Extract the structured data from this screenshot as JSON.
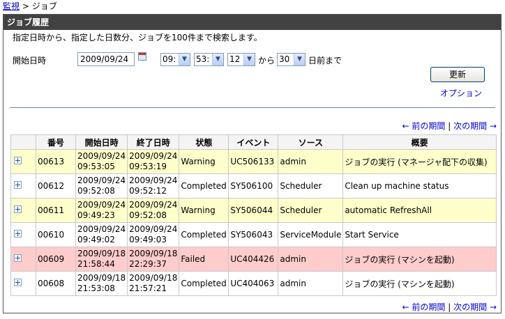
{
  "breadcrumb": {
    "link": "監視",
    "current": "> ジョブ"
  },
  "panel": {
    "title": "ジョブ履歴"
  },
  "search": {
    "description": "指定日時から、指定した日数分、ジョブを100件まで検索します。",
    "start_label": "開始日時",
    "date_value": "2009/09/24",
    "hour": "09:",
    "minute": "53:",
    "second": "12",
    "from_label": "から",
    "days": "30",
    "days_suffix": "日前まで",
    "update_button": "更新",
    "option_link": "オプション"
  },
  "pager": {
    "prev": "← 前の期間",
    "sep": "|",
    "next": "次の期間 →"
  },
  "table": {
    "headers": [
      "",
      "番号",
      "開始日時",
      "終了日時",
      "状態",
      "イベント",
      "ソース",
      "概要"
    ],
    "rows": [
      {
        "id": "00613",
        "start_date": "2009/09/24",
        "start_time": "09:53:05",
        "end_date": "2009/09/24",
        "end_time": "09:53:19",
        "status": "Warning",
        "event": "UC506133",
        "source": "admin",
        "summary": "ジョブの実行 (マネージャ配下の収集)"
      },
      {
        "id": "00612",
        "start_date": "2009/09/24",
        "start_time": "09:52:08",
        "end_date": "2009/09/24",
        "end_time": "09:52:12",
        "status": "Completed",
        "event": "SY506100",
        "source": "Scheduler",
        "summary": "Clean up machine status"
      },
      {
        "id": "00611",
        "start_date": "2009/09/24",
        "start_time": "09:49:23",
        "end_date": "2009/09/24",
        "end_time": "09:52:08",
        "status": "Warning",
        "event": "SY506044",
        "source": "Scheduler",
        "summary": "automatic RefreshAll"
      },
      {
        "id": "00610",
        "start_date": "2009/09/24",
        "start_time": "09:49:02",
        "end_date": "2009/09/24",
        "end_time": "09:49:03",
        "status": "Completed",
        "event": "SY506043",
        "source": "ServiceModule",
        "summary": "Start Service"
      },
      {
        "id": "00609",
        "start_date": "2009/09/18",
        "start_time": "21:58:44",
        "end_date": "2009/09/18",
        "end_time": "22:29:37",
        "status": "Failed",
        "event": "UC404426",
        "source": "admin",
        "summary": "ジョブの実行 (マシンを起動)"
      },
      {
        "id": "00608",
        "start_date": "2009/09/18",
        "start_time": "21:53:08",
        "end_date": "2009/09/18",
        "end_time": "21:57:21",
        "status": "Completed",
        "event": "UC404063",
        "source": "admin",
        "summary": "ジョブの実行 (マシンを起動)"
      }
    ]
  },
  "icons": {
    "expand": "plus-box-icon",
    "calendar": "calendar-icon",
    "dropdown": "chevron-down-icon"
  },
  "colors": {
    "warning_row": "#ffffcc",
    "failed_row": "#ffcccc",
    "title_bar": "#424242",
    "link": "#0000cc"
  }
}
